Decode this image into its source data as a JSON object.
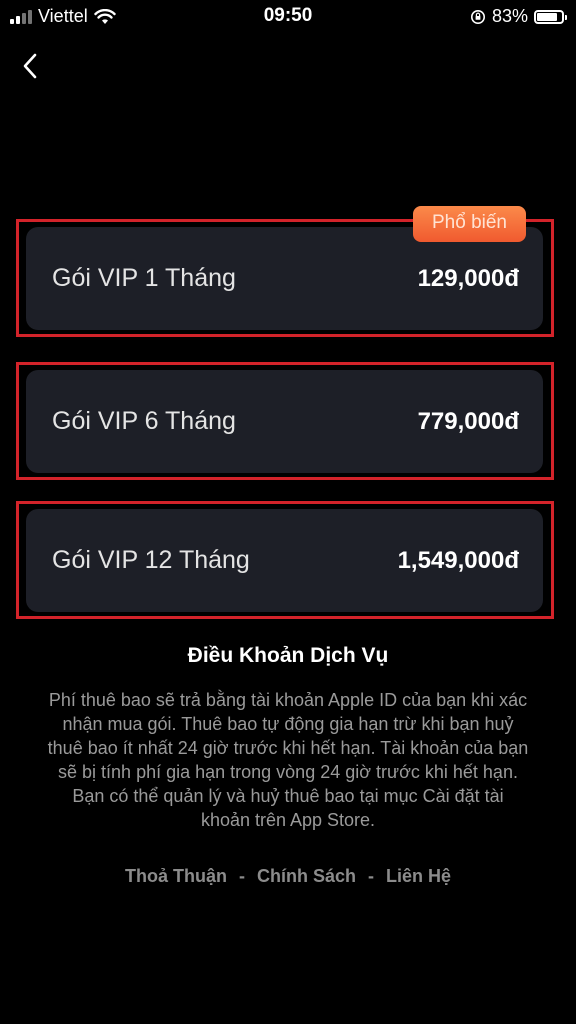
{
  "status_bar": {
    "carrier": "Viettel",
    "time": "09:50",
    "battery_percent": "83%",
    "battery_level": 0.83
  },
  "nav": {
    "back_icon": "chevron-left-icon"
  },
  "badge": {
    "label": "Phổ biến"
  },
  "plans": [
    {
      "name": "Gói VIP 1 Tháng",
      "price": "129,000đ"
    },
    {
      "name": "Gói VIP 6 Tháng",
      "price": "779,000đ"
    },
    {
      "name": "Gói VIP 12 Tháng",
      "price": "1,549,000đ"
    }
  ],
  "terms": {
    "title": "Điều Khoản Dịch Vụ",
    "lines": [
      "Phí thuê bao sẽ trả bằng tài khoản Apple ID của bạn khi xác",
      "nhận mua gói. Thuê bao tự động gia hạn trừ khi bạn huỷ",
      "thuê bao ít nhất 24 giờ trước khi hết hạn. Tài khoản của bạn",
      "sẽ bị tính phí gia hạn trong vòng 24 giờ trước khi hết hạn.",
      "Bạn có thể quản lý và huỷ thuê bao tại mục Cài đặt tài",
      "khoản trên App Store."
    ]
  },
  "footer": {
    "links": [
      "Thoả Thuận",
      "Chính Sách",
      "Liên Hệ"
    ],
    "separator": "-"
  },
  "colors": {
    "background": "#000000",
    "card": "#1d1f27",
    "highlight_border": "#d3232a",
    "badge_start": "#fb8a4a",
    "badge_end": "#f05a2f"
  }
}
